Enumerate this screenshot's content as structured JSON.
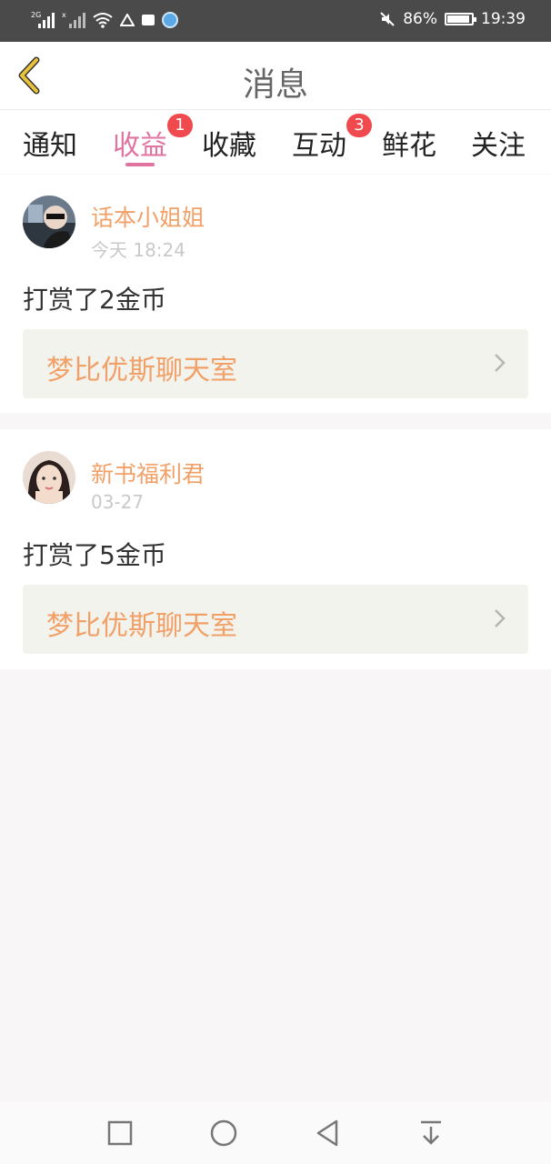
{
  "status_bar": {
    "network_left": "2G",
    "battery": "86%",
    "time": "19:39",
    "icons": [
      "signal-icon",
      "signal-off-icon",
      "wifi-icon",
      "warning-icon",
      "notification-icon",
      "app-icon",
      "mute-icon",
      "battery-icon"
    ]
  },
  "header": {
    "title": "消息"
  },
  "tabs": [
    {
      "label": "通知",
      "badge": ""
    },
    {
      "label": "收益",
      "badge": "1",
      "active": true
    },
    {
      "label": "收藏",
      "badge": ""
    },
    {
      "label": "互动",
      "badge": "3"
    },
    {
      "label": "鲜花",
      "badge": ""
    },
    {
      "label": "关注",
      "badge": ""
    }
  ],
  "messages": [
    {
      "user": "话本小姐姐",
      "time": "今天 18:24",
      "content": "打赏了2金币",
      "link": "梦比优斯聊天室"
    },
    {
      "user": "新书福利君",
      "time": "03-27",
      "content": "打赏了5金币",
      "link": "梦比优斯聊天室"
    }
  ],
  "colors": {
    "accent": "#e0739f",
    "username": "#f1a068",
    "badge": "#f04a4f",
    "back_arrow": "#e8c23a"
  }
}
